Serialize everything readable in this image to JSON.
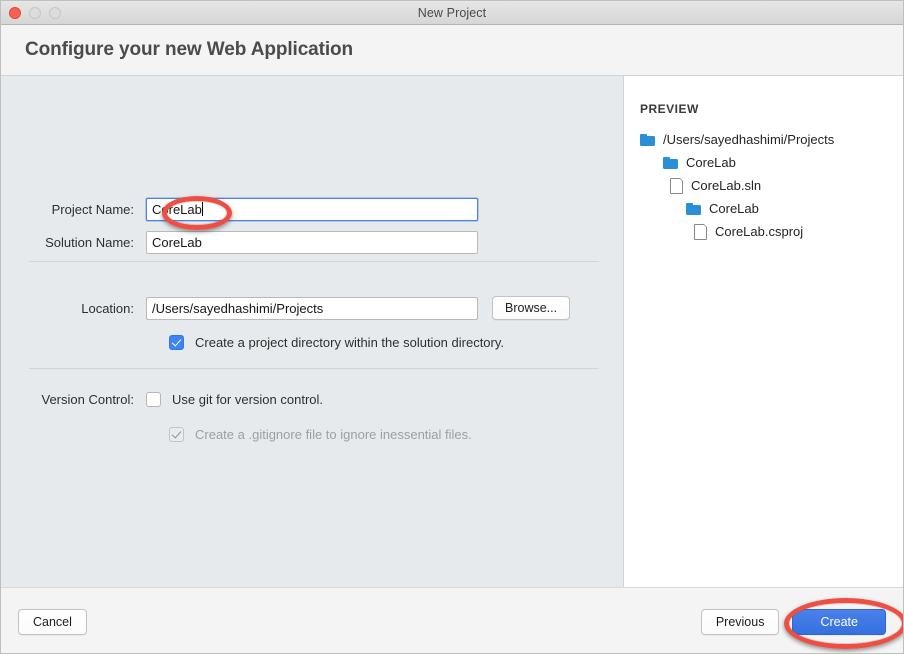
{
  "window": {
    "title": "New Project",
    "traffic_lights": [
      "close",
      "minimize",
      "zoom"
    ]
  },
  "header": {
    "title": "Configure your new Web Application"
  },
  "form": {
    "project_name": {
      "label": "Project Name:",
      "value": "CoreLab",
      "focused": true
    },
    "solution_name": {
      "label": "Solution Name:",
      "value": "CoreLab"
    },
    "location": {
      "label": "Location:",
      "value": "/Users/sayedhashimi/Projects",
      "browse_label": "Browse..."
    },
    "project_directory_checkbox": {
      "label": "Create a project directory within the solution directory.",
      "checked": true,
      "enabled": true
    },
    "version_control": {
      "label": "Version Control:",
      "use_git": {
        "label": "Use git for version control.",
        "checked": false,
        "enabled": true
      },
      "gitignore": {
        "label": "Create a .gitignore file to ignore inessential files.",
        "checked": true,
        "enabled": false
      }
    }
  },
  "preview": {
    "title": "PREVIEW",
    "tree": [
      {
        "label": "/Users/sayedhashimi/Projects",
        "type": "folder",
        "depth": 0
      },
      {
        "label": "CoreLab",
        "type": "folder",
        "depth": 1
      },
      {
        "label": "CoreLab.sln",
        "type": "file",
        "depth": 2
      },
      {
        "label": "CoreLab",
        "type": "folder",
        "depth": 2
      },
      {
        "label": "CoreLab.csproj",
        "type": "file",
        "depth": 3
      }
    ]
  },
  "footer": {
    "cancel_label": "Cancel",
    "previous_label": "Previous",
    "create_label": "Create"
  },
  "colors": {
    "accent_blue": "#3b86f2",
    "primary_button": "#3570e0",
    "folder_blue": "#2b8fd8",
    "annotation_red": "#ef4f43",
    "close_light": "#ff5f52"
  },
  "annotations": [
    {
      "name": "project-name-highlight",
      "target": "project-name-input"
    },
    {
      "name": "create-button-highlight",
      "target": "create-button"
    }
  ]
}
